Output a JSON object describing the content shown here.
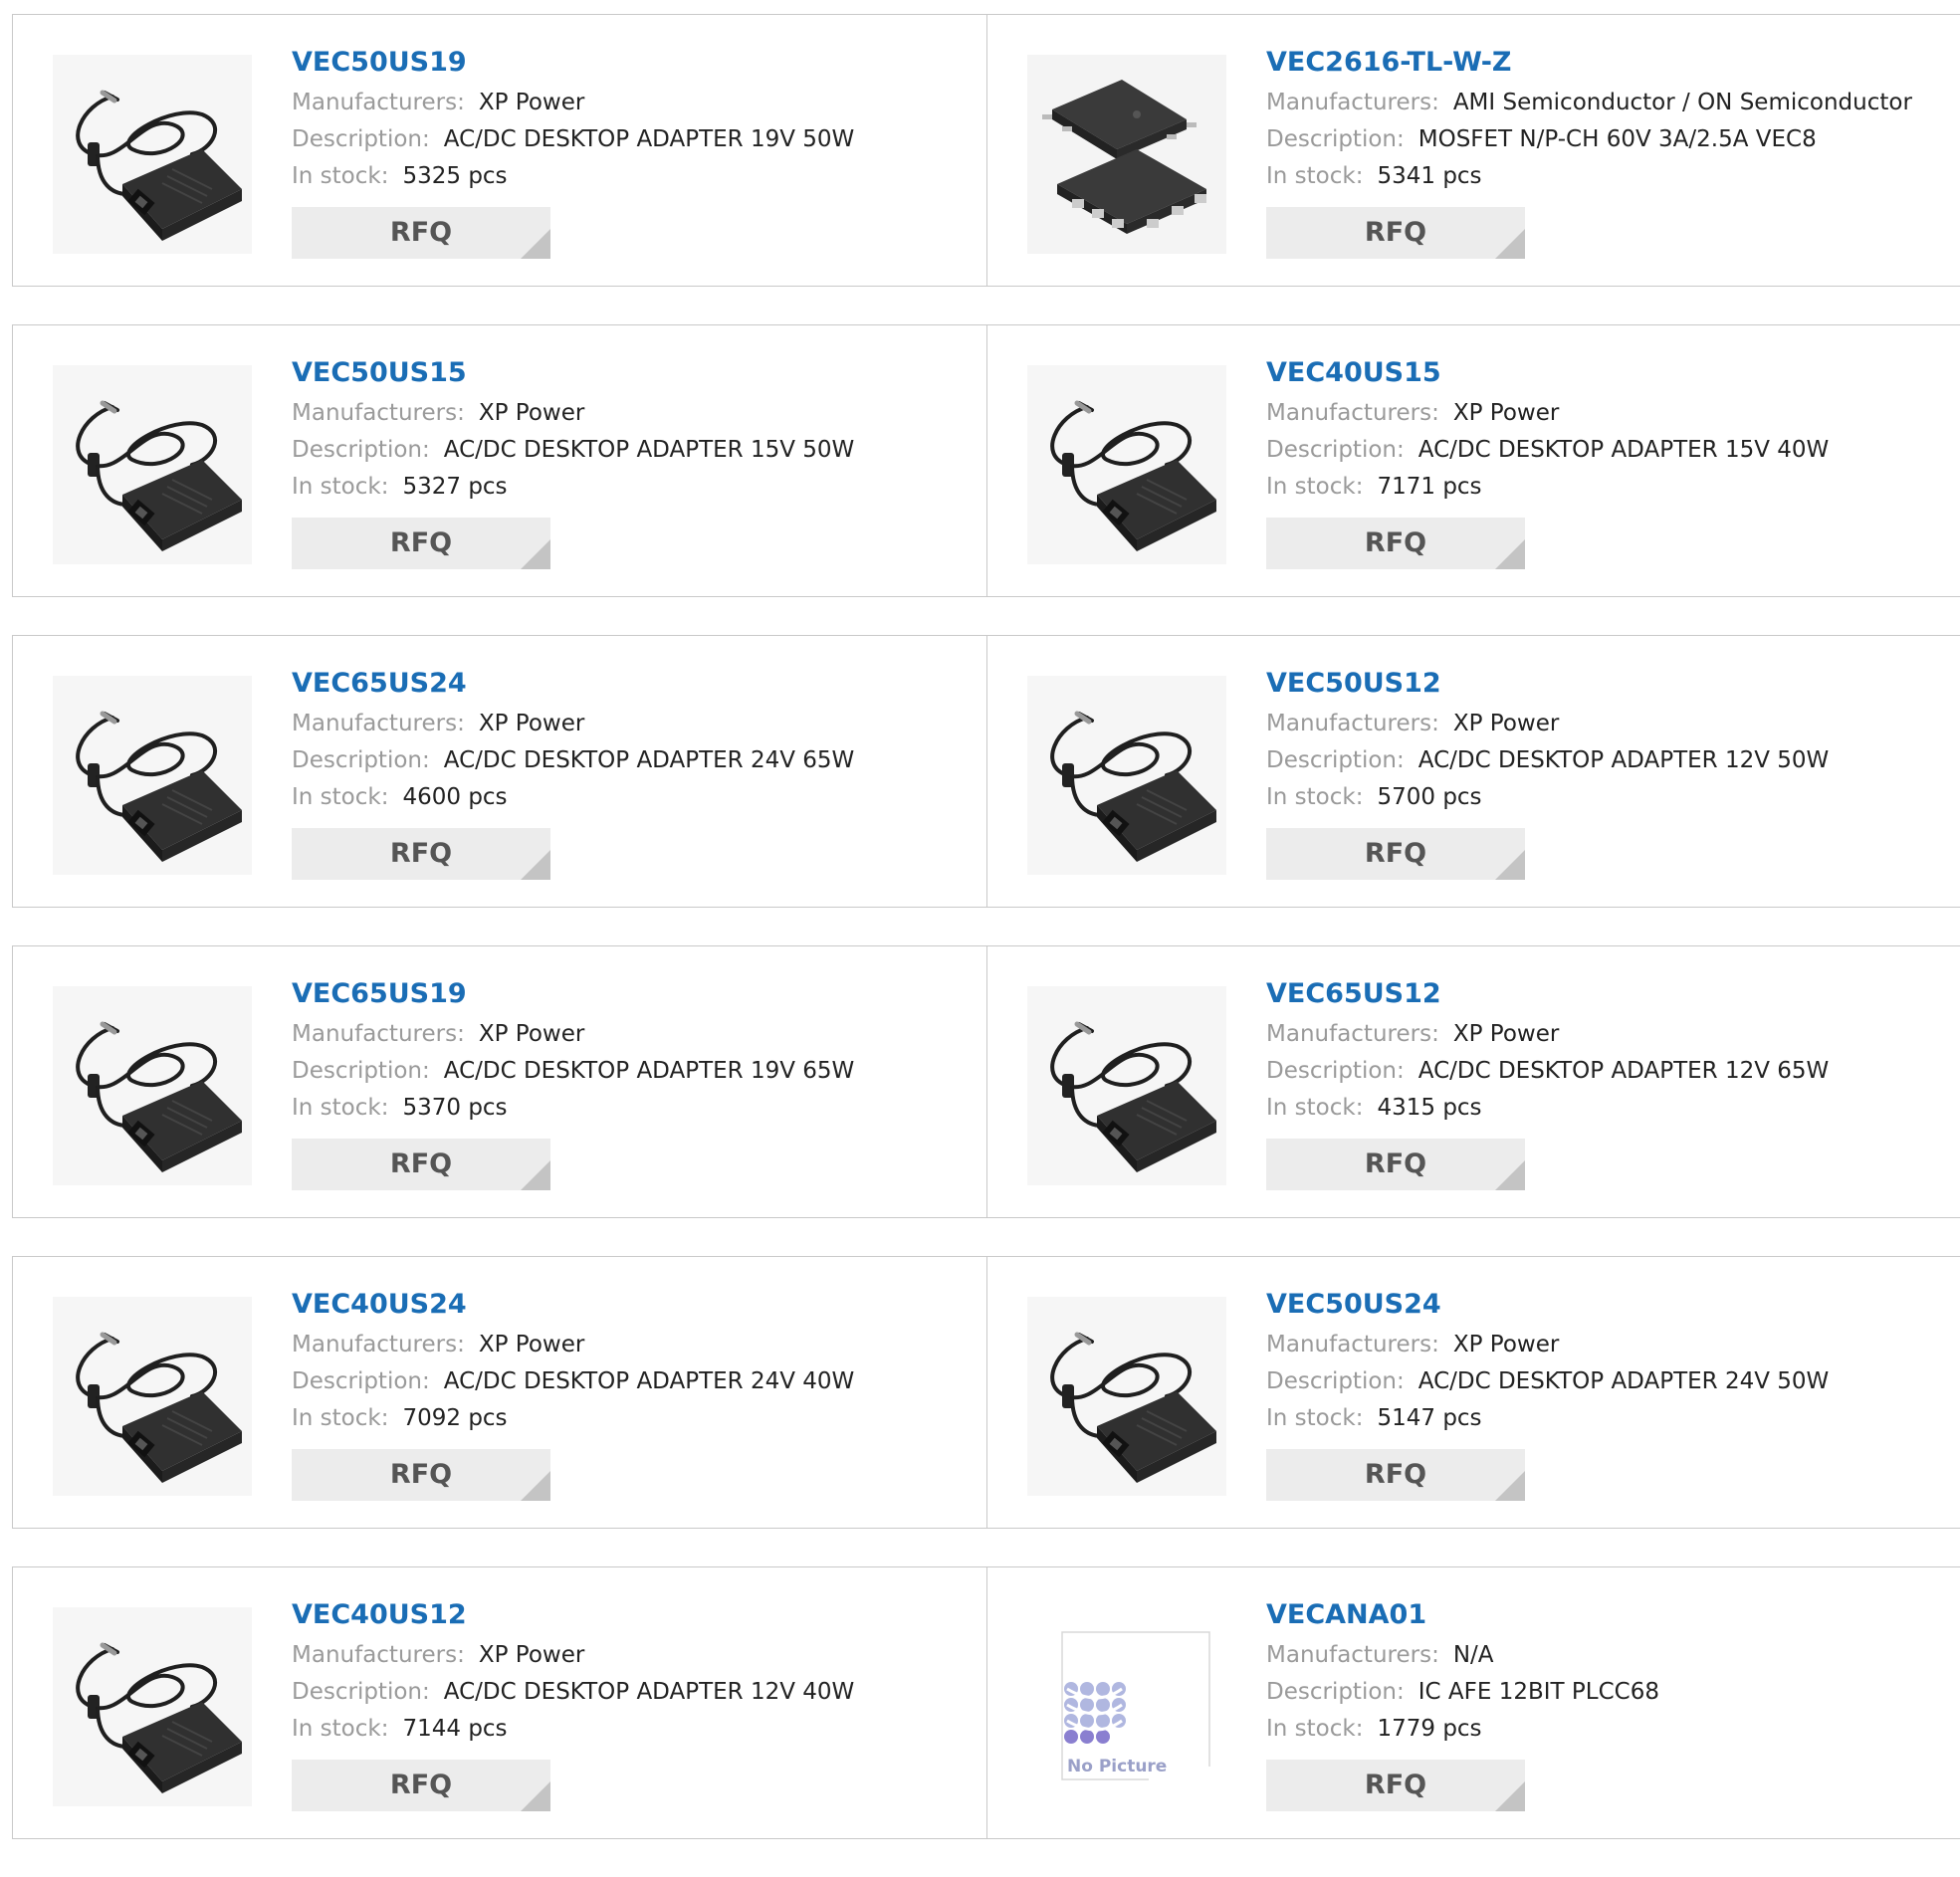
{
  "labels": {
    "manufacturers": "Manufacturers:",
    "description": "Description:",
    "in_stock": "In stock:",
    "rfq": "RFQ",
    "no_picture": "No Picture"
  },
  "colors": {
    "part_link": "#1a6db5",
    "label_grey": "#9a9a9a",
    "rfq_bg": "#ececec",
    "border": "#c9c9c9"
  },
  "products": [
    {
      "part": "VEC50US19",
      "manufacturer": "XP Power",
      "description": "AC/DC DESKTOP ADAPTER 19V 50W",
      "stock": "5325 pcs",
      "image": "adapter-image"
    },
    {
      "part": "VEC2616-TL-W-Z",
      "manufacturer": "AMI Semiconductor / ON Semiconductor",
      "description": "MOSFET N/P-CH 60V 3A/2.5A VEC8",
      "stock": "5341 pcs",
      "image": "chip-image"
    },
    {
      "part": "VEC50US15",
      "manufacturer": "XP Power",
      "description": "AC/DC DESKTOP ADAPTER 15V 50W",
      "stock": "5327 pcs",
      "image": "adapter-image"
    },
    {
      "part": "VEC40US15",
      "manufacturer": "XP Power",
      "description": "AC/DC DESKTOP ADAPTER 15V 40W",
      "stock": "7171 pcs",
      "image": "adapter-image"
    },
    {
      "part": "VEC65US24",
      "manufacturer": "XP Power",
      "description": "AC/DC DESKTOP ADAPTER 24V 65W",
      "stock": "4600 pcs",
      "image": "adapter-image"
    },
    {
      "part": "VEC50US12",
      "manufacturer": "XP Power",
      "description": "AC/DC DESKTOP ADAPTER 12V 50W",
      "stock": "5700 pcs",
      "image": "adapter-image"
    },
    {
      "part": "VEC65US19",
      "manufacturer": "XP Power",
      "description": "AC/DC DESKTOP ADAPTER 19V 65W",
      "stock": "5370 pcs",
      "image": "adapter-image"
    },
    {
      "part": "VEC65US12",
      "manufacturer": "XP Power",
      "description": "AC/DC DESKTOP ADAPTER 12V 65W",
      "stock": "4315 pcs",
      "image": "adapter-image"
    },
    {
      "part": "VEC40US24",
      "manufacturer": "XP Power",
      "description": "AC/DC DESKTOP ADAPTER 24V 40W",
      "stock": "7092 pcs",
      "image": "adapter-image"
    },
    {
      "part": "VEC50US24",
      "manufacturer": "XP Power",
      "description": "AC/DC DESKTOP ADAPTER 24V 50W",
      "stock": "5147 pcs",
      "image": "adapter-image"
    },
    {
      "part": "VEC40US12",
      "manufacturer": "XP Power",
      "description": "AC/DC DESKTOP ADAPTER 12V 40W",
      "stock": "7144 pcs",
      "image": "adapter-image"
    },
    {
      "part": "VECANA01",
      "manufacturer": "N/A",
      "description": "IC AFE 12BIT PLCC68",
      "stock": "1779 pcs",
      "image": "no-picture-image"
    }
  ]
}
